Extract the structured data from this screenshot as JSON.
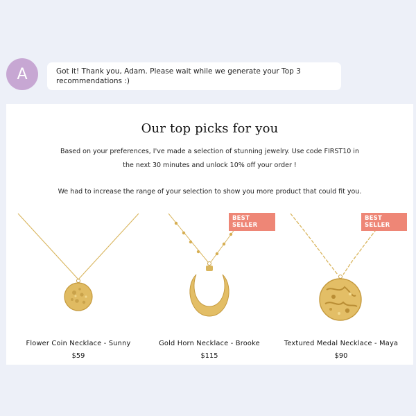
{
  "chat": {
    "avatar_letter": "A",
    "message_line1": "Got it! Thank you, Adam. Please wait while we generate your Top 3",
    "message_line2": "recommendations :)"
  },
  "recommendations": {
    "title": "Our top picks for you",
    "description_line1": "Based on your preferences, I've made a selection of stunning jewelry. Use code FIRST10 in",
    "description_line2": "the next 30 minutes and unlock 10% off your order !",
    "note": "We had to increase the range of your selection to show you more product that could fit you.",
    "products": [
      {
        "name": "Flower Coin Necklace - Sunny",
        "price": "$59",
        "badge": ""
      },
      {
        "name": "Gold Horn Necklace - Brooke",
        "price": "$115",
        "badge": "BEST SELLER"
      },
      {
        "name": "Textured Medal Necklace - Maya",
        "price": "$90",
        "badge": "BEST SELLER"
      }
    ]
  },
  "colors": {
    "background": "#edf0f8",
    "avatar": "#c7a7d3",
    "badge": "#ee8676",
    "gold": "#d9b55d"
  }
}
